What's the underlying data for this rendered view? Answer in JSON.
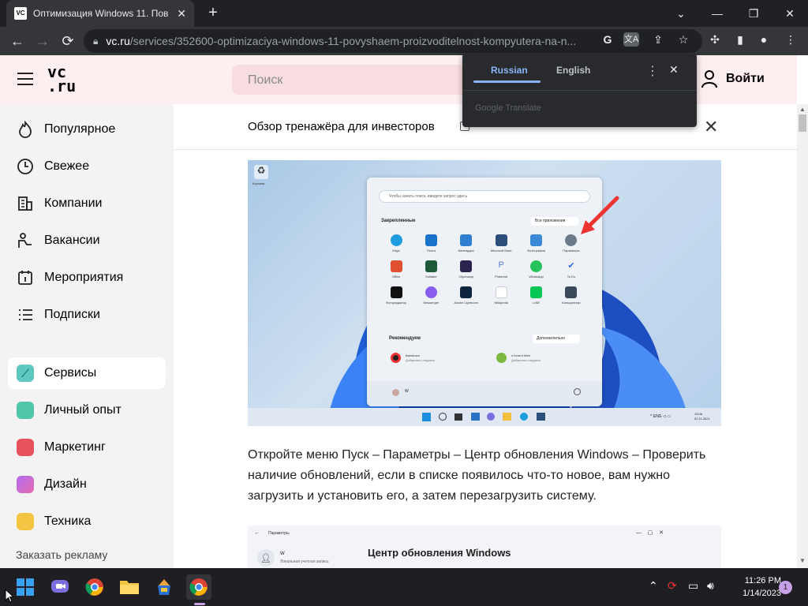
{
  "browser": {
    "tab_title": "Оптимизация Windows 11. Пов",
    "tab_favicon": "VC",
    "url_host": "vc.ru",
    "url_path": "/services/352600-optimizaciya-windows-11-povyshaem-proizvoditelnost-kompyutera-na-n..."
  },
  "header": {
    "logo_line1": "vc",
    "logo_line2": ".ru",
    "search_placeholder": "Поиск",
    "login_label": "Войти"
  },
  "sidebar": {
    "items": [
      {
        "label": "Популярное",
        "icon": "flame-icon"
      },
      {
        "label": "Свежее",
        "icon": "clock-icon"
      },
      {
        "label": "Компании",
        "icon": "building-icon"
      },
      {
        "label": "Вакансии",
        "icon": "person-desk-icon"
      },
      {
        "label": "Мероприятия",
        "icon": "calendar-icon"
      },
      {
        "label": "Подписки",
        "icon": "list-icon"
      }
    ],
    "sections": [
      {
        "label": "Сервисы",
        "color": "#5ec7c0"
      },
      {
        "label": "Личный опыт",
        "color": "#4fc6a8"
      },
      {
        "label": "Маркетинг",
        "color": "#e8505b"
      },
      {
        "label": "Дизайн",
        "color": "#9b6cf0"
      },
      {
        "label": "Техника",
        "color": "#f4c542"
      }
    ],
    "ad_link": "Заказать рекламу"
  },
  "content": {
    "promo": "Обзор тренажёра для инвесторов",
    "paragraph": "Откройте меню Пуск – Параметры – Центр обновления Windows – Проверить наличие обновлений, если в списке появилось что-то новое, вам нужно загрузить и установить его, а затем перезагрузить систему.",
    "img2_breadcrumb": "Параметры",
    "img2_title": "Центр обновления Windows",
    "img2_user": "W",
    "img2_user_sub": "Локальная учетная запись"
  },
  "screenshot_start": {
    "search_placeholder": "Чтобы начать поиск, введите запрос здесь",
    "pinned_label": "Закрепленные",
    "all_apps": "Все приложения",
    "recommended_label": "Рекомендуем",
    "more": "Дополнительно",
    "apps_row1": [
      "Edge",
      "Почта",
      "Календарь",
      "Microsoft Store",
      "Фотографии",
      "Параметры"
    ],
    "apps_row2": [
      "Office",
      "Solitaire",
      "Clipchamp",
      "Pinterest",
      "WhatsApp",
      "To Do"
    ],
    "apps_row3": [
      "Фоторедактор",
      "Messenger",
      "Adobe Lightroom",
      "Wikipedia",
      "LINE",
      "Калькулятор"
    ],
    "rec1": "Bandicam",
    "rec1_sub": "Добавлено недавно",
    "rec2": "uTorrent Web",
    "rec2_sub": "Добавлено недавно",
    "user": "W",
    "recycle": "Корзина"
  },
  "translate_popup": {
    "tab_source": "Russian",
    "tab_target": "English",
    "brand": "Google Translate"
  },
  "taskbar": {
    "time": "11:26 PM",
    "date": "1/14/2023",
    "notifications": "1"
  },
  "colors": {
    "header_bg": "#fdeef0",
    "accent": "#8ab4f8"
  }
}
